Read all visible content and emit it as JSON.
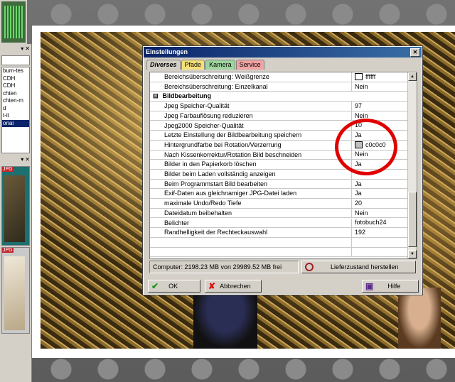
{
  "left_panel": {
    "list_items": [
      "bum-tes",
      "CDH",
      "CDH",
      "chten",
      "chten-m",
      "d",
      "t-it",
      "oriai"
    ],
    "selected_index": 7,
    "thumb_tag_1": "JPG",
    "thumb_tag_2": "JPG"
  },
  "dialog": {
    "title": "Einstellungen",
    "close_label": "✕",
    "tabs": [
      {
        "label": "Diverses",
        "active": true
      },
      {
        "label": "Pfade",
        "active": false
      },
      {
        "label": "Kamera",
        "active": false
      },
      {
        "label": "Service",
        "active": false
      }
    ],
    "rows": [
      {
        "label": "Bereichsüberschreitung: Weißgrenze",
        "value": "ffffff",
        "swatch": "#ffffff"
      },
      {
        "label": "Bereichsüberschreitung: Einzelkanal",
        "value": "Nein"
      },
      {
        "label": "Bildbearbeitung",
        "section": true,
        "toggle": "⊟"
      },
      {
        "label": "Jpeg Speicher-Qualität",
        "value": "97"
      },
      {
        "label": "Jpeg Farbauflösung reduzieren",
        "value": "Nein"
      },
      {
        "label": "Jpeg2000 Speicher-Qualität",
        "value": "10"
      },
      {
        "label": "Letzte Einstellung der Bildbearbeitung speichern",
        "value": "Ja"
      },
      {
        "label": "Hintergrundfarbe bei Rotation/Verzerrung",
        "value": "c0c0c0",
        "swatch": "#c0c0c0"
      },
      {
        "label": "Nach Kissenkorrektur/Rotation Bild beschneiden",
        "value": "Nein"
      },
      {
        "label": "Bilder in den Papierkorb löschen",
        "value": "Ja"
      },
      {
        "label": "Bilder beim Laden vollständig anzeigen",
        "value": ""
      },
      {
        "label": "Beim Programmstart Bild bearbeiten",
        "value": "Ja"
      },
      {
        "label": "Exif-Daten aus gleichnamiger JPG-Datei laden",
        "value": "Ja"
      },
      {
        "label": "maximale Undo/Redo Tiefe",
        "value": "20"
      },
      {
        "label": "Dateidatum beibehalten",
        "value": "Nein"
      },
      {
        "label": "Belichter",
        "value": "fotobuch24"
      },
      {
        "label": "Randhelligkeit der Rechteckauswahl",
        "value": "192"
      },
      {
        "label": "",
        "value": ""
      },
      {
        "label": "",
        "value": ""
      }
    ],
    "status_text": "Computer: 2198.23 MB von 29989.52 MB frei",
    "reset_label": "Lieferzustand herstellen",
    "ok_label": "OK",
    "cancel_label": "Abbrechen",
    "help_label": "Hilfe"
  },
  "colors": {
    "titlebar": "#0a246a",
    "annotation_circle": "#e00000",
    "tab_pfade": "#f4e07a",
    "tab_kamera": "#9fd59f",
    "tab_service": "#f2a3a3"
  }
}
